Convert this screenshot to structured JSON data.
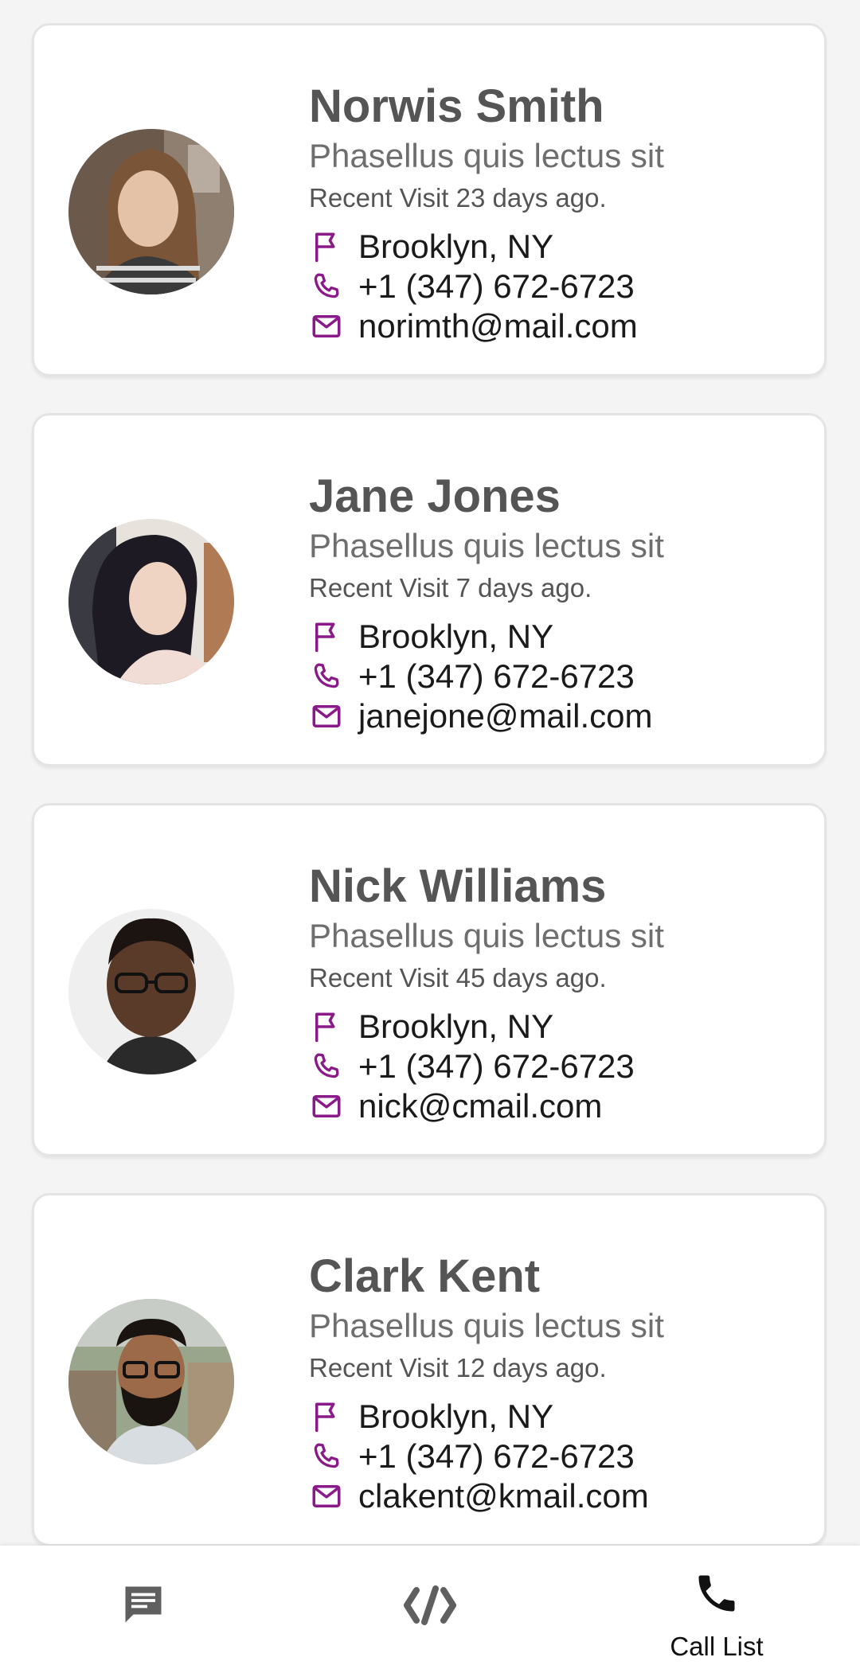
{
  "accent_color": "#8a1a8a",
  "contacts": [
    {
      "name": "Norwis Smith",
      "subtitle": "Phasellus quis lectus sit",
      "visit": "Recent Visit 23 days ago.",
      "location": "Brooklyn, NY",
      "phone": "+1 (347) 672-6723",
      "email": "norimth@mail.com"
    },
    {
      "name": "Jane Jones",
      "subtitle": "Phasellus quis lectus sit",
      "visit": "Recent Visit 7 days ago.",
      "location": "Brooklyn, NY",
      "phone": "+1 (347) 672-6723",
      "email": "janejone@mail.com"
    },
    {
      "name": "Nick Williams",
      "subtitle": "Phasellus quis lectus sit",
      "visit": "Recent Visit 45 days ago.",
      "location": "Brooklyn, NY",
      "phone": "+1 (347) 672-6723",
      "email": "nick@cmail.com"
    },
    {
      "name": "Clark Kent",
      "subtitle": "Phasellus quis lectus sit",
      "visit": "Recent Visit 12 days ago.",
      "location": "Brooklyn, NY",
      "phone": "+1 (347) 672-6723",
      "email": "clakent@kmail.com"
    }
  ],
  "bottom_nav": {
    "items": [
      {
        "icon": "chat-icon",
        "label": ""
      },
      {
        "icon": "code-icon",
        "label": ""
      },
      {
        "icon": "phone-icon",
        "label": "Call List"
      }
    ]
  }
}
